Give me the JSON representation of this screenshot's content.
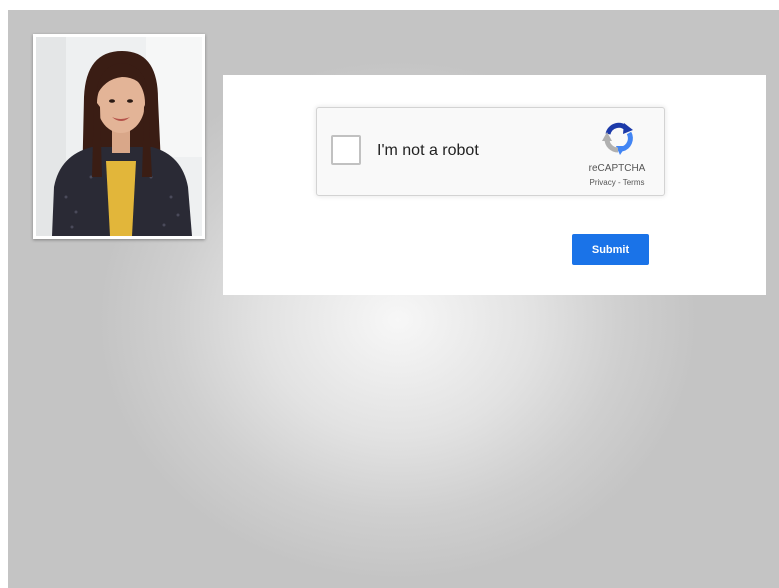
{
  "recaptcha": {
    "checkbox_label": "I'm not a robot",
    "brand": "reCAPTCHA",
    "privacy_link": "Privacy",
    "separator": " - ",
    "terms_link": "Terms",
    "checked": false
  },
  "form": {
    "submit_label": "Submit"
  },
  "colors": {
    "submit_bg": "#1a73e8",
    "logo_dark_blue": "#1c3aa9",
    "logo_blue": "#4285f4",
    "logo_grey": "#b0b0b0"
  },
  "icons": {
    "recaptcha_logo": "recaptcha-logo-icon",
    "presenter": "presenter-photo"
  }
}
